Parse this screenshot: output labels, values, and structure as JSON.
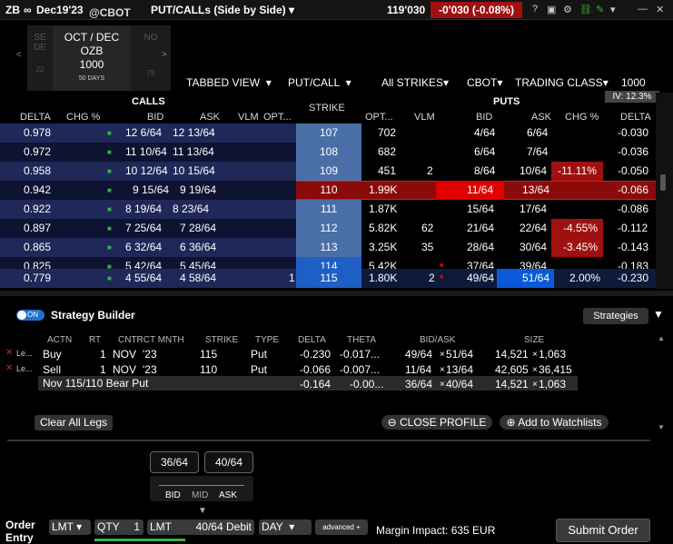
{
  "titlebar": {
    "symbol": "ZB",
    "link_glyph": "∞",
    "contract": "Dec19'23",
    "exchange": "@CBOT",
    "view": "PUT/CALLs (Side by Side)",
    "price": "119'030",
    "change": "-0'030 (-0.08%)"
  },
  "expiries": {
    "prev_label_1": "SE",
    "prev_label_2": "DE",
    "prev_label_3": "22",
    "active_line1": "OCT / DEC",
    "active_line2": "OZB",
    "active_line3": "1000",
    "active_line4": "50 DAYS",
    "next_label_1": "NO",
    "next_label_2": "79"
  },
  "toolbar": {
    "tabbed_view": "TABBED VIEW",
    "put_call": "PUT/CALL",
    "all_strikes": "All STRIKES",
    "exchange": "CBOT",
    "trading_class": "TRADING CLASS",
    "multiplier": "1000",
    "iv": "IV: 12.3%"
  },
  "chain": {
    "calls_label": "CALLS",
    "puts_label": "PUTS",
    "strike_label": "STRIKE",
    "call_headers": {
      "delta": "DELTA",
      "chg": "CHG %",
      "bid": "BID",
      "ask": "ASK",
      "vlm": "VLM",
      "opt": "OPT..."
    },
    "put_headers": {
      "opt": "OPT...",
      "vlm": "VLM",
      "bid": "BID",
      "ask": "ASK",
      "chg": "CHG %",
      "delta": "DELTA"
    },
    "rows": [
      {
        "c_delta": "0.978",
        "c_bid": "12 6/64",
        "c_ask": "12 13/64",
        "c_vlm": "",
        "strike": "107",
        "p_opt": "702",
        "p_vlm": "",
        "p_bid": "4/64",
        "p_ask": "6/64",
        "p_chg": "",
        "p_delta": "-0.030"
      },
      {
        "c_delta": "0.972",
        "c_bid": "11 10/64",
        "c_ask": "11 13/64",
        "c_vlm": "",
        "strike": "108",
        "p_opt": "682",
        "p_vlm": "",
        "p_bid": "6/64",
        "p_ask": "7/64",
        "p_chg": "",
        "p_delta": "-0.036"
      },
      {
        "c_delta": "0.958",
        "c_bid": "10 12/64",
        "c_ask": "10 15/64",
        "c_vlm": "",
        "strike": "109",
        "p_opt": "451",
        "p_vlm": "2",
        "p_bid": "8/64",
        "p_ask": "10/64",
        "p_chg": "-11.11%",
        "p_delta": "-0.050"
      },
      {
        "c_delta": "0.942",
        "c_bid": "9 15/64",
        "c_ask": "9 19/64",
        "c_vlm": "",
        "strike": "110",
        "p_opt": "1.99K",
        "p_vlm": "",
        "p_bid": "11/64",
        "p_ask": "13/64",
        "p_chg": "",
        "p_delta": "-0.066"
      },
      {
        "c_delta": "0.922",
        "c_bid": "8 19/64",
        "c_ask": "8 23/64",
        "c_vlm": "",
        "strike": "111",
        "p_opt": "1.87K",
        "p_vlm": "",
        "p_bid": "15/64",
        "p_ask": "17/64",
        "p_chg": "",
        "p_delta": "-0.086"
      },
      {
        "c_delta": "0.897",
        "c_bid": "7 25/64",
        "c_ask": "7 28/64",
        "c_vlm": "",
        "strike": "112",
        "p_opt": "5.82K",
        "p_vlm": "62",
        "p_bid": "21/64",
        "p_ask": "22/64",
        "p_chg": "-4.55%",
        "p_delta": "-0.112"
      },
      {
        "c_delta": "0.865",
        "c_bid": "6 32/64",
        "c_ask": "6 36/64",
        "c_vlm": "",
        "strike": "113",
        "p_opt": "3.25K",
        "p_vlm": "35",
        "p_bid": "28/64",
        "p_ask": "30/64",
        "p_chg": "-3.45%",
        "p_delta": "-0.143"
      },
      {
        "c_delta": "0.825",
        "c_bid": "5 42/64",
        "c_ask": "5 45/64",
        "c_vlm": "",
        "strike": "114",
        "p_opt": "5.42K",
        "p_vlm": "",
        "p_bid": "37/64",
        "p_ask": "39/64",
        "p_chg": "",
        "p_delta": "-0.183"
      },
      {
        "c_delta": "0.779",
        "c_bid": "4 55/64",
        "c_ask": "4 58/64",
        "c_vlm": "1",
        "strike": "115",
        "p_opt": "1.80K",
        "p_vlm": "2",
        "p_bid": "49/64",
        "p_ask": "51/64",
        "p_chg": "2.00%",
        "p_delta": "-0.230"
      }
    ]
  },
  "strategy": {
    "toggle": "ON",
    "title": "Strategy Builder",
    "strategies_button": "Strategies",
    "headers": {
      "actn": "ACTN",
      "rt": "RT",
      "cntrct": "CNTRCT MNTH",
      "strike": "STRIKE",
      "type": "TYPE",
      "delta": "DELTA",
      "theta": "THETA",
      "bidask": "BID/ASK",
      "size": "SIZE"
    },
    "legs": [
      {
        "leg": "Le...",
        "actn": "Buy",
        "rt": "1",
        "month": "NOV",
        "year": "'23",
        "strike": "115",
        "type": "Put",
        "delta": "-0.230",
        "theta": "-0.017...",
        "bid": "49/64",
        "ask": "51/64",
        "size_bid": "14,521",
        "size_ask": "1,063"
      },
      {
        "leg": "Le...",
        "actn": "Sell",
        "rt": "1",
        "month": "NOV",
        "year": "'23",
        "strike": "110",
        "type": "Put",
        "delta": "-0.066",
        "theta": "-0.007...",
        "bid": "11/64",
        "ask": "13/64",
        "size_bid": "42,605",
        "size_ask": "36,415"
      }
    ],
    "summary": {
      "name": "Nov 115/110 Bear Put",
      "delta": "-0.164",
      "theta": "-0.00...",
      "bid": "36/64",
      "ask": "40/64",
      "size_bid": "14,521",
      "size_ask": "1,063"
    },
    "clear_all": "Clear All Legs",
    "close_profile": "CLOSE PROFILE",
    "add_watchlists": "Add to Watchlists"
  },
  "pricebox": {
    "bid": "36/64",
    "ask": "40/64",
    "bid_label": "BID",
    "mid_label": "MID",
    "ask_label": "ASK"
  },
  "order": {
    "label": "Order Entry",
    "type": "LMT",
    "qty_label": "QTY",
    "qty": "1",
    "price_type": "LMT",
    "price": "40/64 Debit",
    "tif": "DAY",
    "advanced": "advanced",
    "margin": "Margin Impact: 635 EUR",
    "submit": "Submit Order"
  },
  "colors": {
    "call_row_dark": "#0d1330",
    "call_row_light": "#1f2859",
    "strike_bg": "#4a6fa8",
    "atm_red": "#8b0b0b",
    "bright_red": "#e00000",
    "ask_blue": "#0a5ad8"
  }
}
